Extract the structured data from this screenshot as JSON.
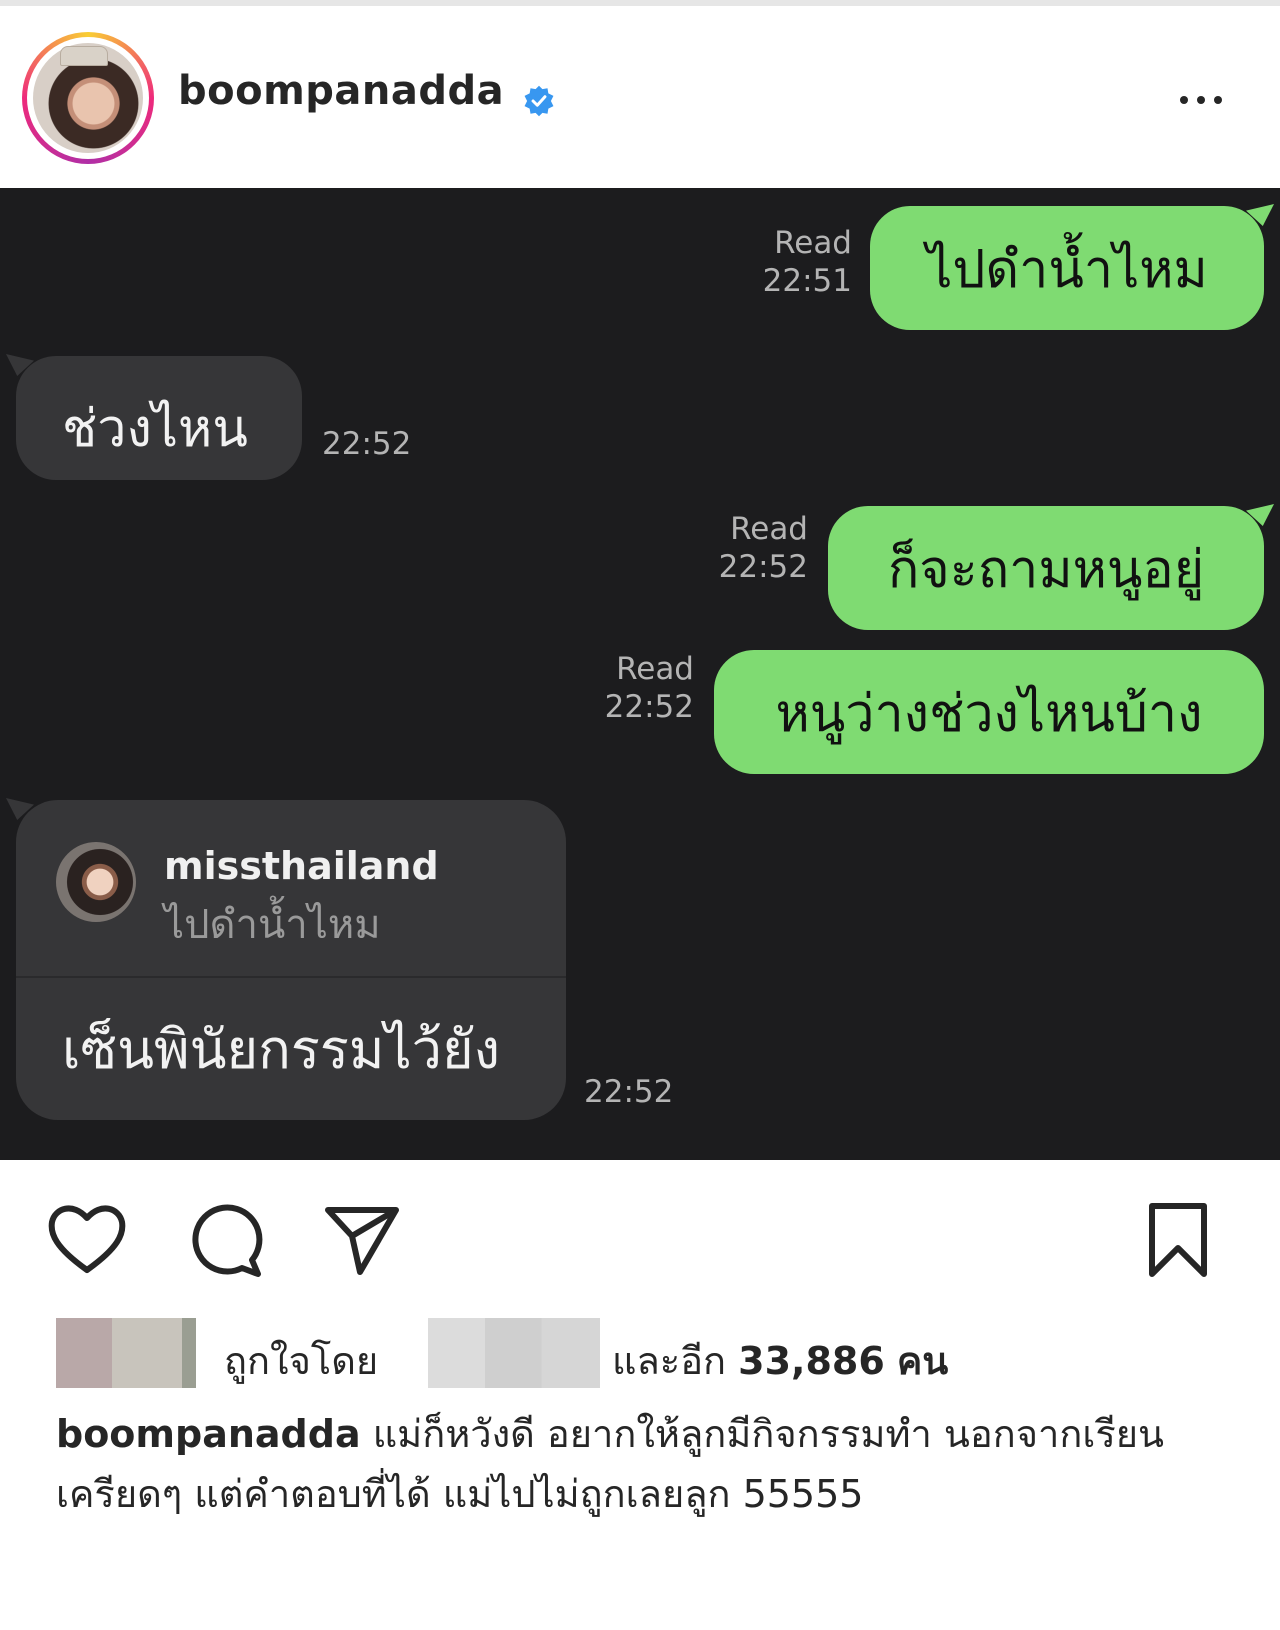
{
  "post": {
    "username": "boompanadda",
    "verified": true,
    "more_icon": "more-horizontal-icon"
  },
  "chat": {
    "messages": [
      {
        "direction": "out",
        "text": "ไปดำน้ำไหม",
        "status": "Read",
        "time": "22:51"
      },
      {
        "direction": "in",
        "text": "ช่วงไหน",
        "time": "22:52"
      },
      {
        "direction": "out",
        "text": "ก็จะถามหนูอยู่",
        "status": "Read",
        "time": "22:52"
      },
      {
        "direction": "out",
        "text": "หนูว่างช่วงไหนบ้าง",
        "status": "Read",
        "time": "22:52"
      },
      {
        "direction": "in",
        "reply_to": {
          "name": "missthailand",
          "quote": "ไปดำน้ำไหม"
        },
        "text": "เซ็นพินัยกรรมไว้ยัง",
        "time": "22:52"
      }
    ]
  },
  "actions": {
    "like_icon": "heart-icon",
    "comment_icon": "comment-icon",
    "share_icon": "send-icon",
    "save_icon": "bookmark-icon"
  },
  "likes": {
    "prefix": "ถูกใจโดย",
    "middle": "และอีก",
    "count": "33,886",
    "suffix": "คน"
  },
  "caption": {
    "username": "boompanadda",
    "text": "แม่ก็หวังดี อยากให้ลูกมีกิจกรรมทำ นอกจากเรียนเครียดๆ แต่คำตอบที่ได้ แม่ไปไม่ถูกเลยลูก 55555"
  },
  "colors": {
    "chat_bg": "#1c1c1e",
    "outgoing_bubble": "#7fdb72",
    "incoming_bubble": "#363638",
    "verified_blue": "#3897f0"
  }
}
